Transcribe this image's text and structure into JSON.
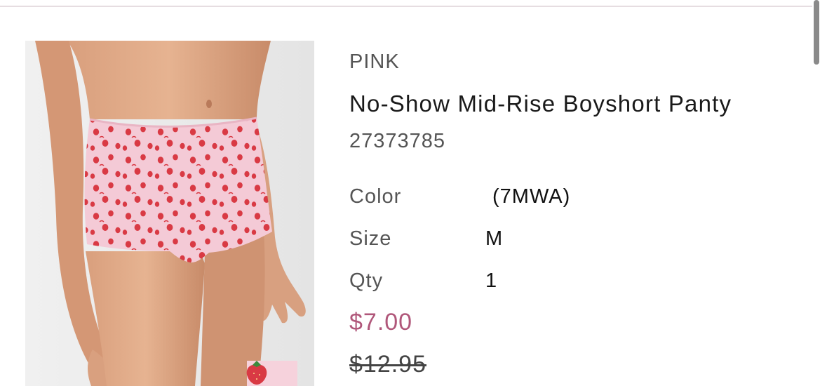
{
  "product": {
    "brand": "PINK",
    "name": "No-Show Mid-Rise Boyshort Panty",
    "sku": "27373785",
    "attributes": [
      {
        "label": "Color",
        "value": "(7MWA)"
      },
      {
        "label": "Size",
        "value": "M"
      },
      {
        "label": "Qty",
        "value": "1"
      }
    ],
    "sale_price": "$7.00",
    "original_price": "$12.95",
    "image_icon": "strawberry-icon"
  },
  "colors": {
    "sale_price": "#b0577a",
    "accent_pink": "#f3c9d6",
    "strawberry_red": "#d93a44"
  }
}
